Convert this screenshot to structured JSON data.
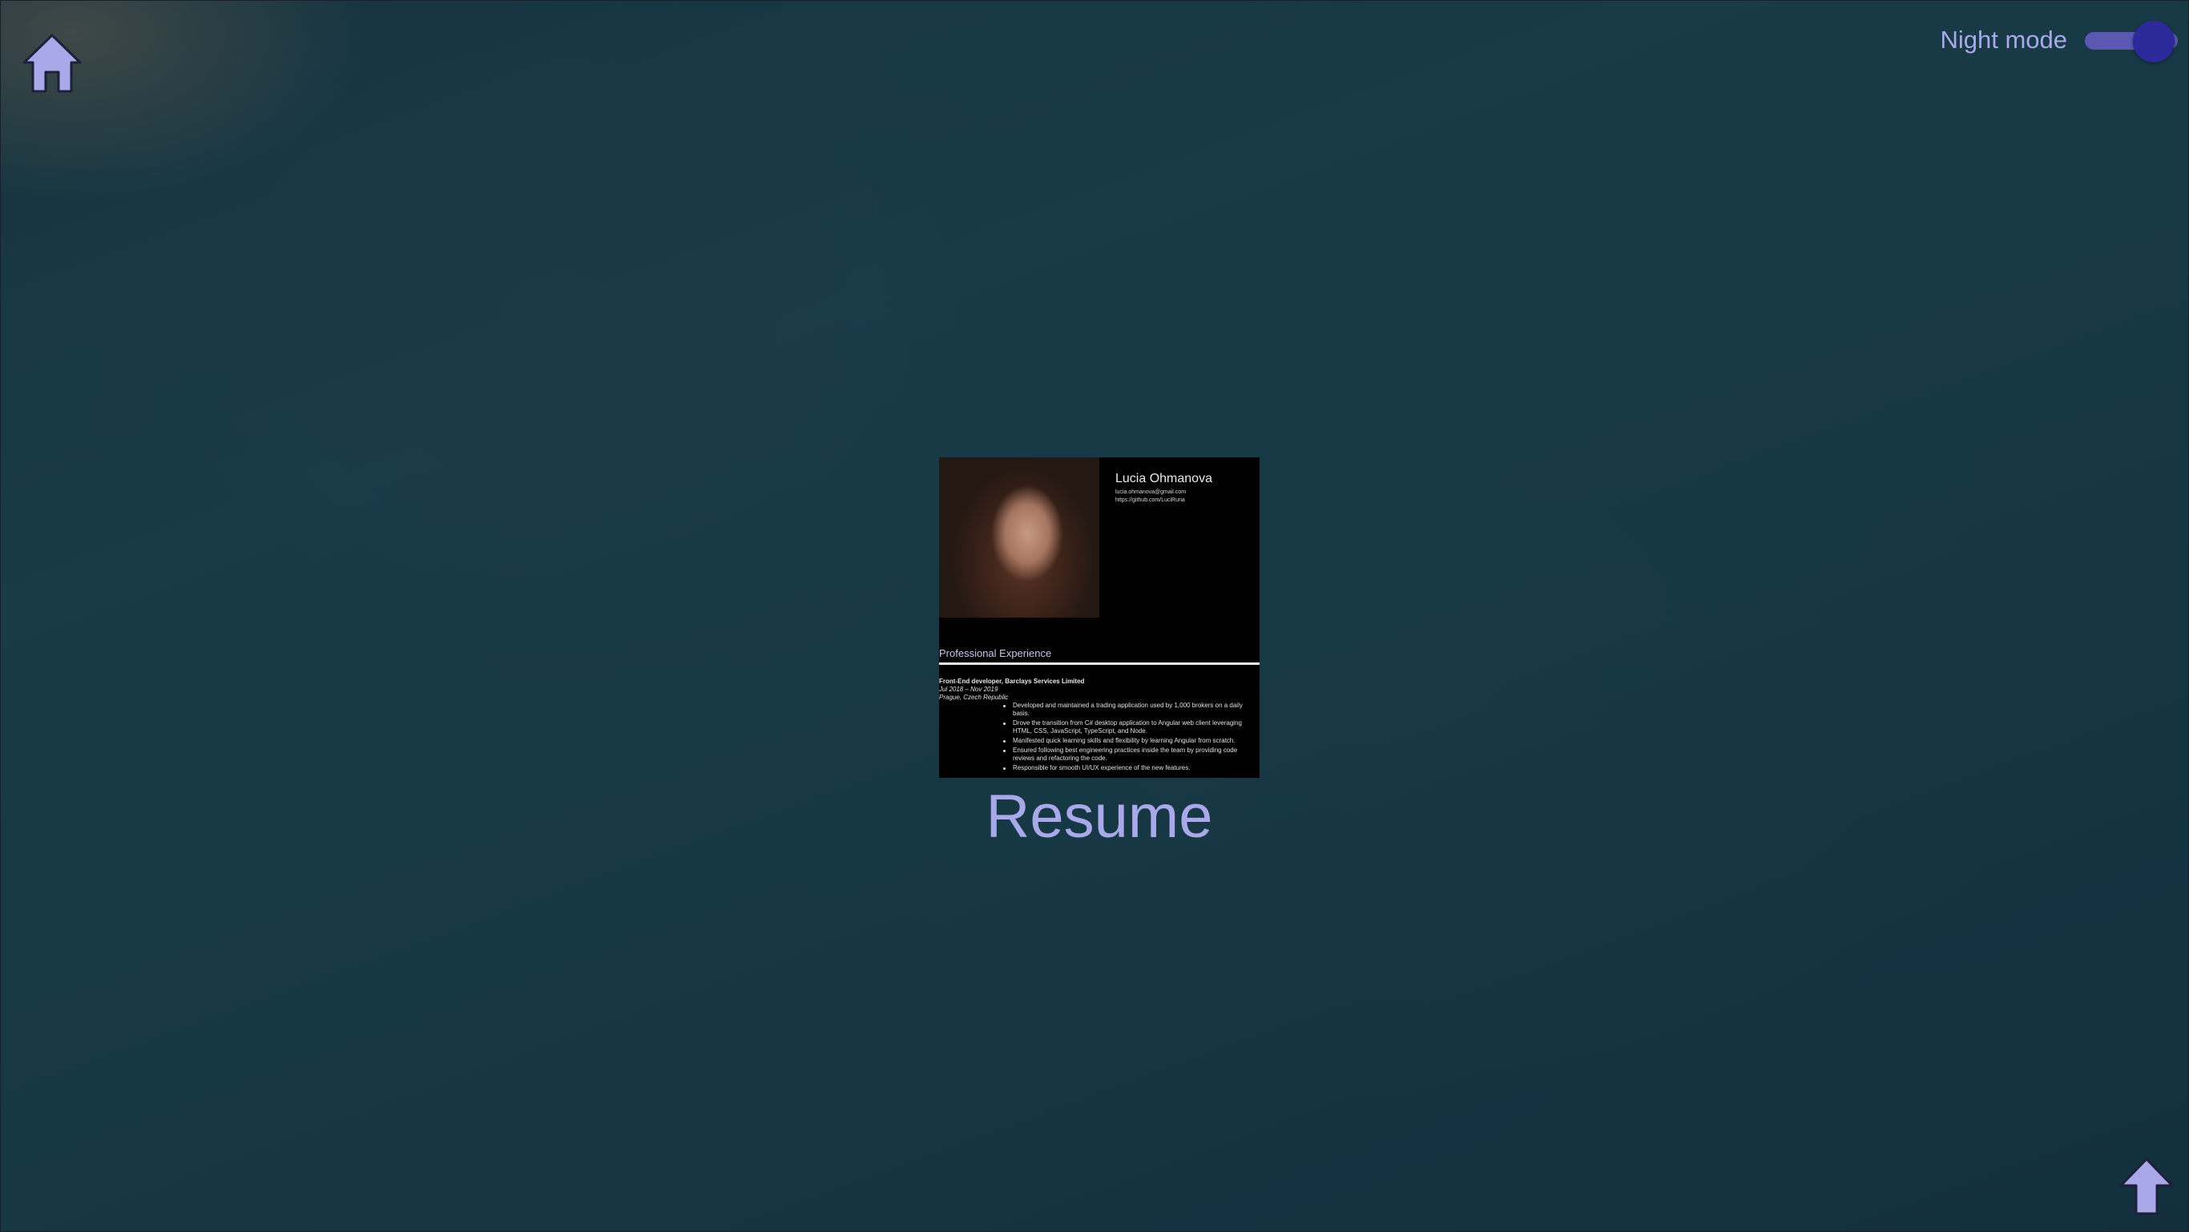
{
  "header": {
    "home_icon": "home-icon",
    "night_mode_label": "Night mode",
    "night_mode_on": true
  },
  "card": {
    "title": "Resume",
    "resume": {
      "name": "Lucia Ohmanova",
      "email": "lucia.ohmanova@gmail.com",
      "github": "https://github.com/LuciRuria",
      "section_title": "Professional Experience",
      "job_title": "Front-End developer, Barclays Services Limited",
      "job_dates": "Jul 2018 – Nov 2019",
      "job_place": "Prague, Czech Republic",
      "bullets": [
        "Developed and maintained a trading application used by 1,000 brokers on a daily basis.",
        "Drove the transition from C# desktop application to Angular web client leveraging HTML, CSS, JavaScript, TypeScript, and Node.",
        "Manifested quick learning skills and flexibility by learning Angular from scratch.",
        "Ensured following best engineering practices inside the team by providing code reviews and refactoring the code.",
        "Responsible for smooth UI/UX experience of the new features."
      ]
    }
  },
  "footer": {
    "scroll_top_icon": "arrow-up-icon"
  },
  "colors": {
    "accent": "#a9a8e8",
    "toggle_track": "#5a58b0",
    "toggle_knob": "#2c2a9a",
    "background": "#1d4855"
  }
}
